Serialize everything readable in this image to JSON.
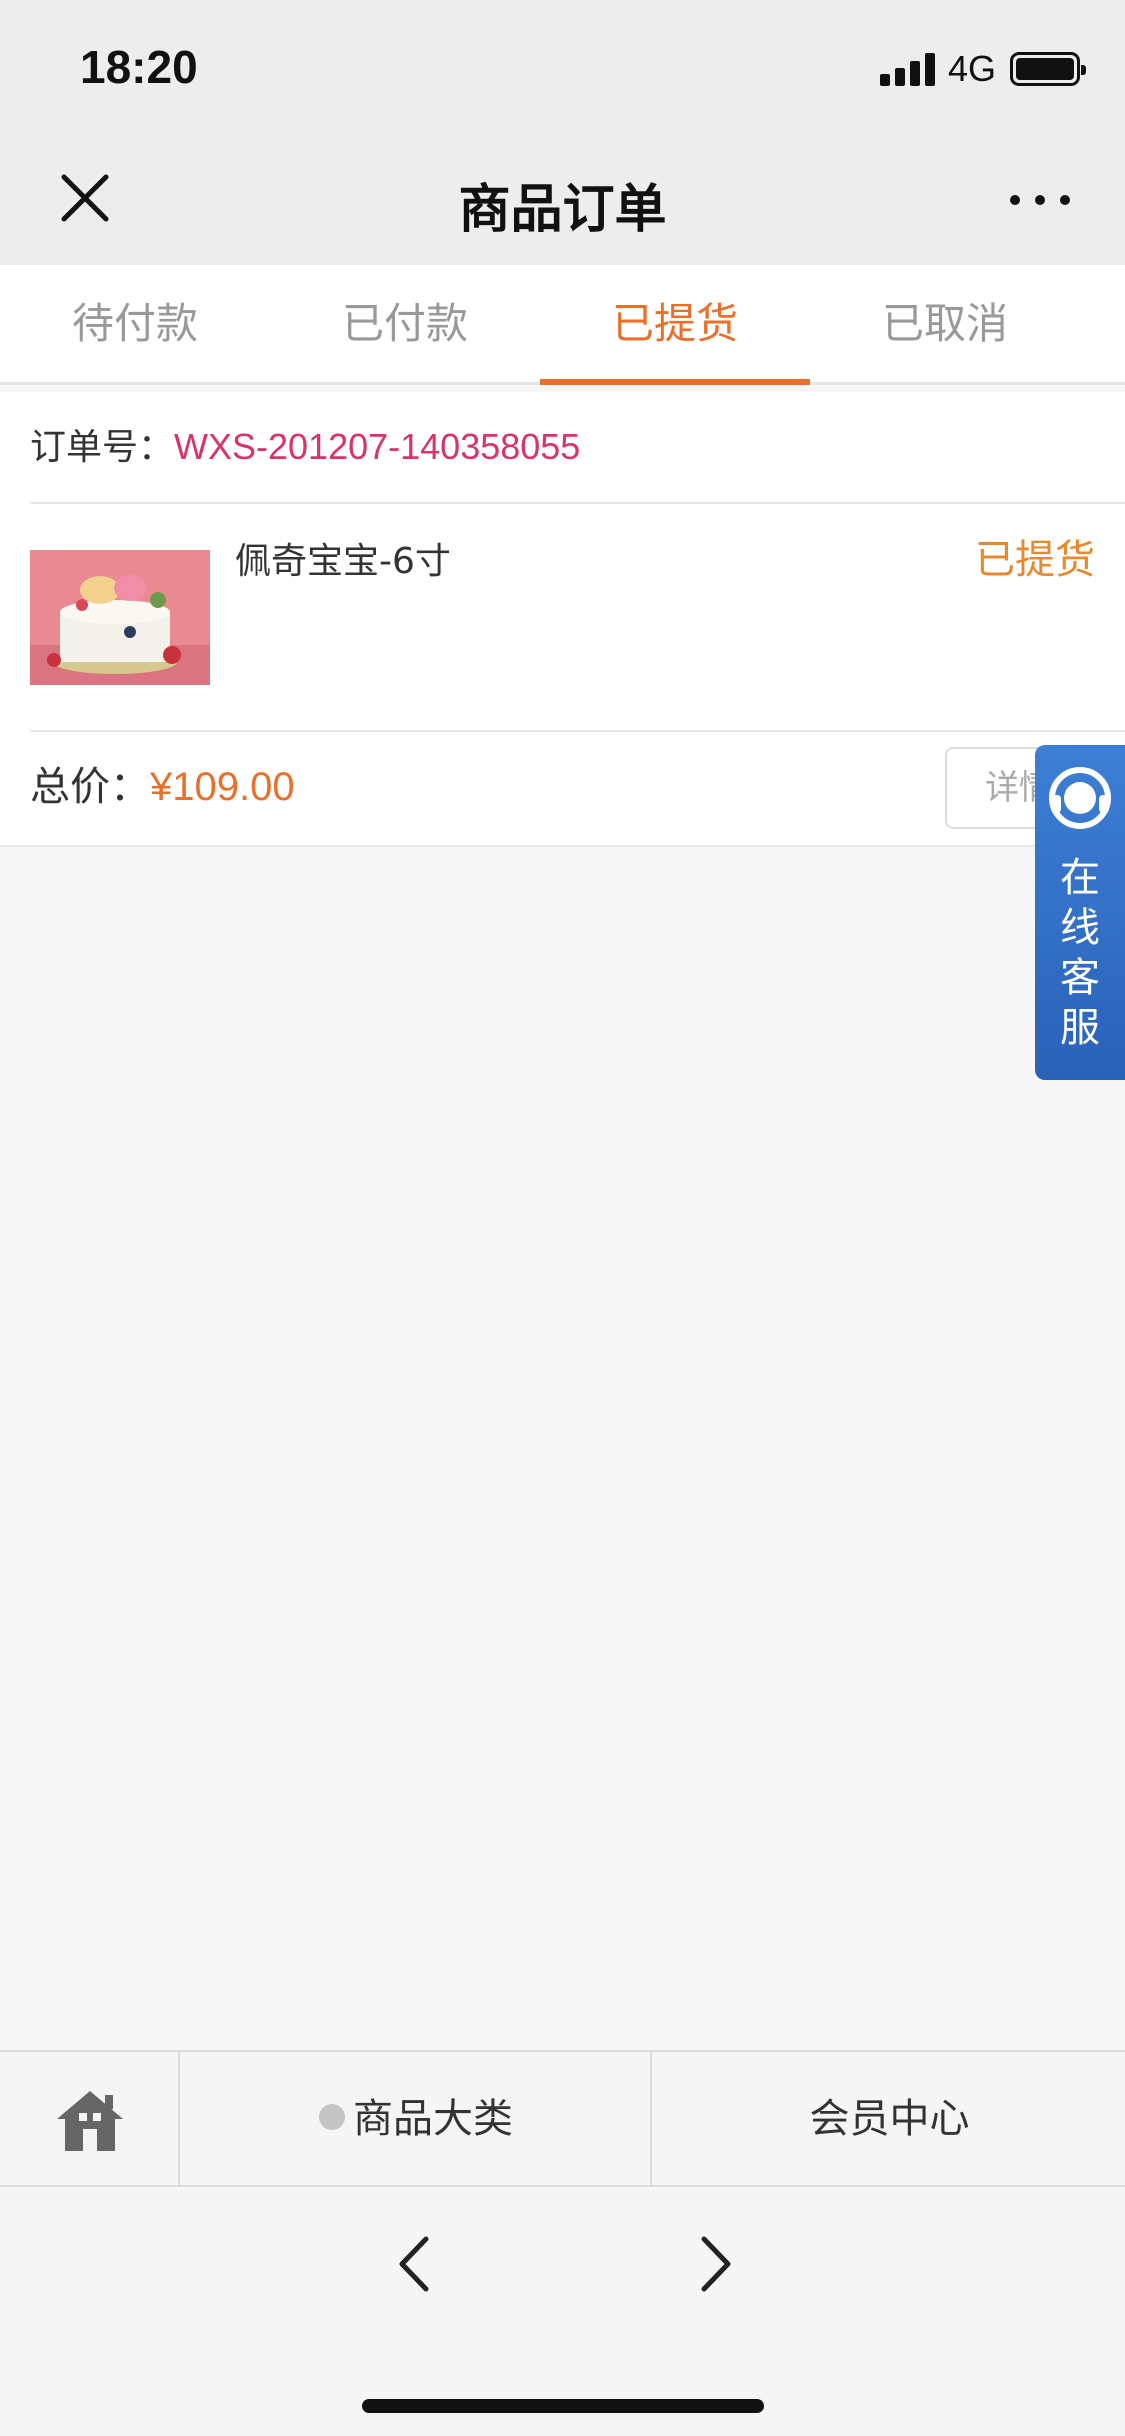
{
  "status_bar": {
    "time": "18:20",
    "network": "4G"
  },
  "nav": {
    "title": "商品订单"
  },
  "tabs": [
    {
      "label": "待付款",
      "active": false
    },
    {
      "label": "已付款",
      "active": false
    },
    {
      "label": "已提货",
      "active": true
    },
    {
      "label": "已取消",
      "active": false
    }
  ],
  "order": {
    "number_label": "订单号：",
    "number": "WXS-201207-140358055",
    "product_name": "佩奇宝宝-6寸",
    "status": "已提货",
    "total_label": "总价：",
    "total": "¥109.00",
    "detail_label": "详情"
  },
  "service": {
    "label": "在线客服"
  },
  "bottom_menu": {
    "home_icon": "home-icon",
    "category_label": "商品大类",
    "member_label": "会员中心"
  },
  "colors": {
    "accent": "#e8702a",
    "order_number": "#d8336a",
    "service": "#3d7fd6"
  }
}
